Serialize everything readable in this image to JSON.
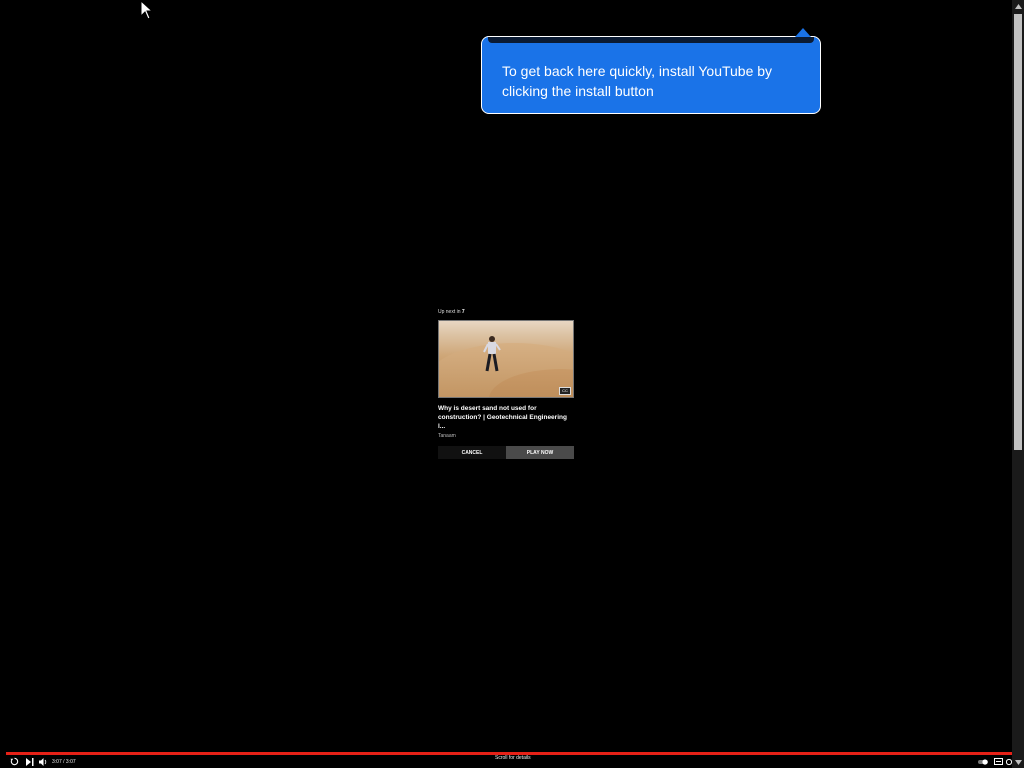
{
  "tooltip": {
    "text": "To get back here quickly, install YouTube by clicking the install button"
  },
  "up_next": {
    "countdown_label": "Up next in",
    "countdown_value": "7",
    "title": "Why is desert sand not used for construction? | Geotechnical Engineering l...",
    "channel": "Tanaam",
    "cancel_label": "CANCEL",
    "play_label": "PLAY NOW",
    "cc_badge": "CC"
  },
  "player": {
    "time": "3:07 / 3:07",
    "scroll_hint": "Scroll for details",
    "progress_fraction": 1.0,
    "accent_color": "#e62117"
  },
  "colors": {
    "tooltip_bg": "#1a73e8",
    "background": "#000000"
  },
  "icons": {
    "replay": "replay-icon",
    "next": "next-icon",
    "volume": "volume-icon",
    "autoplay": "autoplay-toggle-icon",
    "subtitles": "subtitles-icon",
    "settings": "settings-icon"
  }
}
